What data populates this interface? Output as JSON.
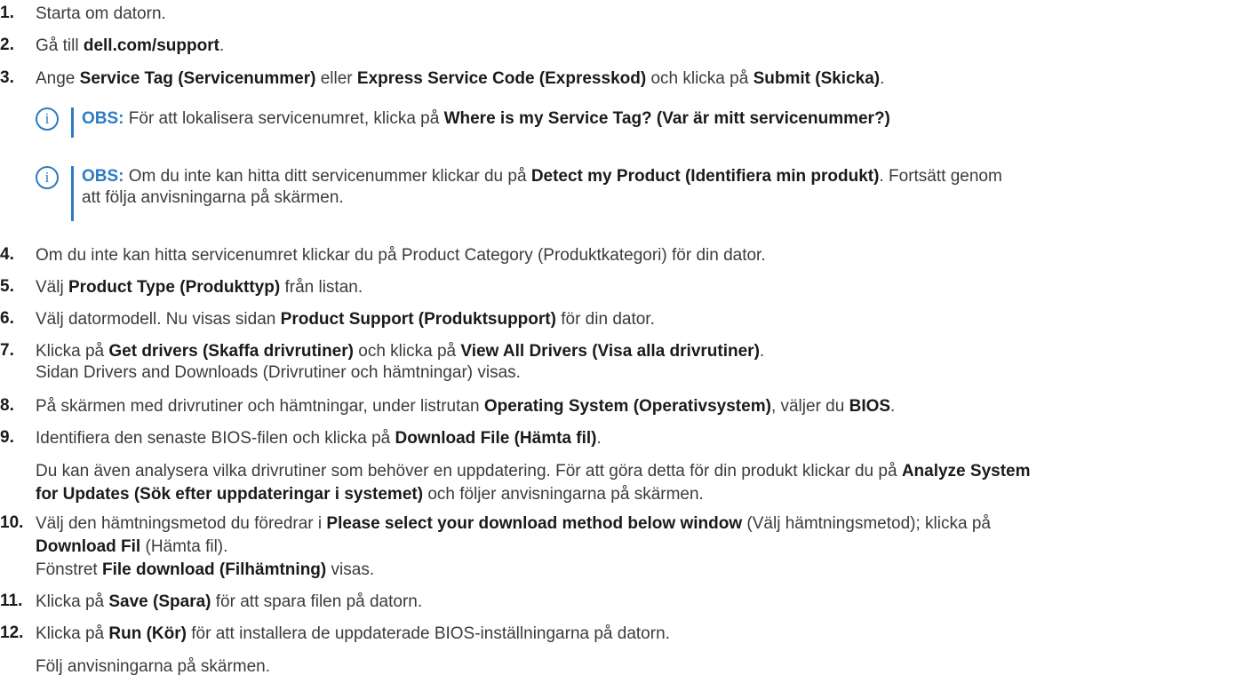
{
  "steps": [
    {
      "num": "1.",
      "segs": [
        {
          "t": "Starta om datorn."
        }
      ]
    },
    {
      "num": "2.",
      "segs": [
        {
          "t": "Gå till "
        },
        {
          "t": "dell.com/support",
          "b": true
        },
        {
          "t": "."
        }
      ]
    },
    {
      "num": "3.",
      "segs": [
        {
          "t": "Ange "
        },
        {
          "t": "Service Tag (Servicenummer)",
          "b": true
        },
        {
          "t": " eller "
        },
        {
          "t": "Express Service Code (Expresskod)",
          "b": true
        },
        {
          "t": " och klicka på "
        },
        {
          "t": "Submit (Skicka)",
          "b": true
        },
        {
          "t": "."
        }
      ]
    },
    {
      "num": "4.",
      "segs": [
        {
          "t": "Om du inte kan hitta servicenumret klickar du på Product Category (Produktkategori) för din dator."
        }
      ]
    },
    {
      "num": "5.",
      "segs": [
        {
          "t": "Välj "
        },
        {
          "t": "Product Type (Produkttyp)",
          "b": true
        },
        {
          "t": " från listan."
        }
      ]
    },
    {
      "num": "6.",
      "segs": [
        {
          "t": "Välj datormodell. Nu visas sidan "
        },
        {
          "t": "Product Support (Produktsupport)",
          "b": true
        },
        {
          "t": " för din dator."
        }
      ]
    },
    {
      "num": "7.",
      "segs": [
        {
          "t": "Klicka på "
        },
        {
          "t": "Get drivers (Skaffa drivrutiner)",
          "b": true
        },
        {
          "t": " och klicka på "
        },
        {
          "t": "View All Drivers (Visa alla drivrutiner)",
          "b": true
        },
        {
          "t": "."
        }
      ]
    },
    {
      "num": "8.",
      "segs": [
        {
          "t": "På skärmen med drivrutiner och hämtningar, under listrutan "
        },
        {
          "t": "Operating System (Operativsystem)",
          "b": true
        },
        {
          "t": ", väljer du "
        },
        {
          "t": "BIOS",
          "b": true
        },
        {
          "t": "."
        }
      ]
    },
    {
      "num": "9.",
      "segs": [
        {
          "t": "Identifiera den senaste BIOS-filen och klicka på "
        },
        {
          "t": "Download File (Hämta fil)",
          "b": true
        },
        {
          "t": "."
        }
      ]
    },
    {
      "num": "10.",
      "segs": [
        {
          "t": "Välj den hämtningsmetod du föredrar i "
        },
        {
          "t": "Please select your download method below window",
          "b": true
        },
        {
          "t": " (Välj hämtningsmetod); klicka på"
        }
      ]
    },
    {
      "num": "11.",
      "segs": [
        {
          "t": "Klicka på "
        },
        {
          "t": "Save (Spara)",
          "b": true
        },
        {
          "t": " för att spara filen på datorn."
        }
      ]
    },
    {
      "num": "12.",
      "segs": [
        {
          "t": "Klicka på "
        },
        {
          "t": "Run (Kör)",
          "b": true
        },
        {
          "t": " för att installera de uppdaterade BIOS-inställningarna på datorn."
        }
      ]
    }
  ],
  "notes": [
    {
      "icon": "i",
      "label": "OBS:",
      "lines": [
        [
          {
            "t": " För att lokalisera servicenumret, klicka på "
          },
          {
            "t": "Where is my Service Tag? (Var är mitt servicenummer?)",
            "b": true
          }
        ]
      ]
    },
    {
      "icon": "i",
      "label": "OBS:",
      "lines": [
        [
          {
            "t": " Om du inte kan hitta ditt servicenummer klickar du på "
          },
          {
            "t": "Detect my Product (Identifiera min produkt)",
            "b": true
          },
          {
            "t": ". Fortsätt genom"
          }
        ],
        [
          {
            "t": "att följa anvisningarna på skärmen."
          }
        ]
      ]
    }
  ],
  "extra": {
    "s7": [
      {
        "t": "Sidan Drivers and Downloads (Drivrutiner och hämtningar) visas."
      }
    ],
    "s9_l1": [
      {
        "t": "Du kan även analysera vilka drivrutiner som behöver en uppdatering. För att göra detta för din produkt klickar du på "
      },
      {
        "t": "Analyze System",
        "b": true
      }
    ],
    "s9_l2": [
      {
        "t": "for Updates (Sök efter uppdateringar i systemet)",
        "b": true
      },
      {
        "t": " och följer anvisningarna på skärmen."
      }
    ],
    "s10_l2": [
      {
        "t": "Download Fil",
        "b": true
      },
      {
        "t": " (Hämta fil)."
      }
    ],
    "s10_l3": [
      {
        "t": "Fönstret "
      },
      {
        "t": "File download (Filhämtning)",
        "b": true
      },
      {
        "t": " visas."
      }
    ],
    "s12": [
      {
        "t": "Följ anvisningarna på skärmen."
      }
    ]
  }
}
